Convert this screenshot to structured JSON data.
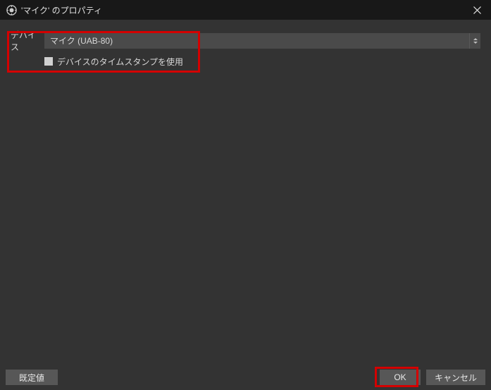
{
  "titlebar": {
    "title": "'マイク' のプロパティ"
  },
  "form": {
    "device_label": "デバイス",
    "device_value": "マイク (UAB-80)",
    "timestamp_checkbox_label": "デバイスのタイムスタンプを使用"
  },
  "footer": {
    "defaults_label": "既定値",
    "ok_label": "OK",
    "cancel_label": "キャンセル"
  }
}
